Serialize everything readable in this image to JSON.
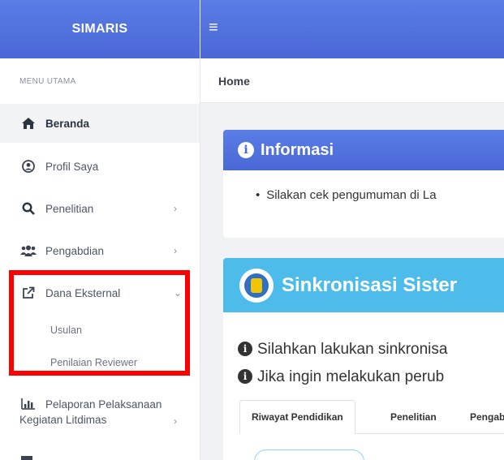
{
  "brand": {
    "title": "SIMARIS"
  },
  "topbar": {
    "menu_icon": "hamburger-icon"
  },
  "breadcrumb": {
    "label": "Home"
  },
  "sidebar": {
    "section_title": "MENU UTAMA",
    "items": [
      {
        "label": "Beranda",
        "icon": "home-icon",
        "active": true
      },
      {
        "label": "Profil Saya",
        "icon": "user-circle-icon"
      },
      {
        "label": "Penelitian",
        "icon": "search-icon",
        "chevron": "›"
      },
      {
        "label": "Pengabdian",
        "icon": "users-icon",
        "chevron": "›"
      },
      {
        "label": "Dana Eksternal",
        "icon": "external-link-icon",
        "chevron": "⌄"
      },
      {
        "label_line1": "Pelaporan Pelaksanaan",
        "label_line2": "Kegiatan Litdimas",
        "icon": "bar-chart-icon",
        "chevron": "›"
      }
    ],
    "sub_items": [
      {
        "label": "Usulan"
      },
      {
        "label": "Penilaian Reviewer"
      }
    ]
  },
  "info_card": {
    "title": "Informasi",
    "bullet": "Silakan cek pengumuman di La"
  },
  "sister_card": {
    "title": "Sinkronisasi Sister",
    "line1": "Silahkan lakukan sinkronisa",
    "line2": "Jika ingin melakukan perub",
    "tabs": [
      "Riwayat Pendidikan",
      "Penelitian",
      "Pengab"
    ]
  },
  "colors": {
    "brand": "#4a68d6",
    "sister_header": "#4dbcea",
    "highlight": "#ff0000"
  }
}
